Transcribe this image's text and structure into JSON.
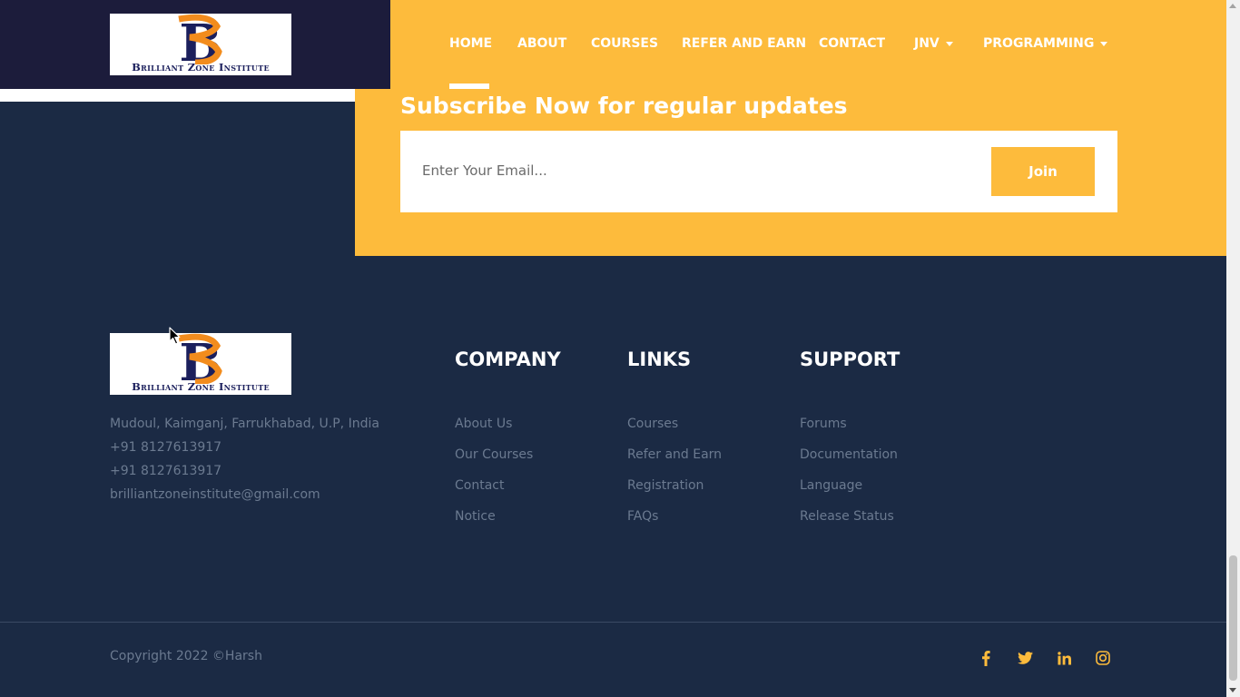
{
  "brand": {
    "logo_letter": "B",
    "logo_text": "Brilliant Zone Institute",
    "colors": {
      "navy": "#1b1f5c",
      "orange": "#f28c1d"
    }
  },
  "nav": {
    "items": [
      {
        "label": "HOME",
        "active": true
      },
      {
        "label": "ABOUT"
      },
      {
        "label": "COURSES"
      },
      {
        "label": "REFER AND EARN"
      },
      {
        "label": "CONTACT"
      },
      {
        "label": "JNV",
        "dropdown": true
      },
      {
        "label": "PROGRAMMING",
        "dropdown": true
      }
    ]
  },
  "subscribe": {
    "title": "Subscribe Now for regular updates",
    "placeholder": "Enter Your Email...",
    "button_label": "Join"
  },
  "footer": {
    "address_lines": [
      "Mudoul, Kaimganj, Farrukhabad, U.P, India",
      "+91 8127613917",
      "+91 8127613917",
      "brilliantzoneinstitute@gmail.com"
    ],
    "columns": [
      {
        "title": "COMPANY",
        "links": [
          "About Us",
          "Our Courses",
          "Contact",
          "Notice"
        ]
      },
      {
        "title": "LINKS",
        "links": [
          "Courses",
          "Refer and Earn",
          "Registration",
          "FAQs"
        ]
      },
      {
        "title": "SUPPORT",
        "links": [
          "Forums",
          "Documentation",
          "Language",
          "Release Status"
        ]
      }
    ],
    "copyright": "Copyright 2022 ©Harsh",
    "social_icons": [
      "facebook-icon",
      "twitter-icon",
      "linkedin-icon",
      "instagram-icon"
    ]
  },
  "theme": {
    "accent": "#fdbb3c",
    "footer_bg": "#1b2a44",
    "header_dark": "#1c1c3b",
    "muted_text": "#6b7a90"
  }
}
